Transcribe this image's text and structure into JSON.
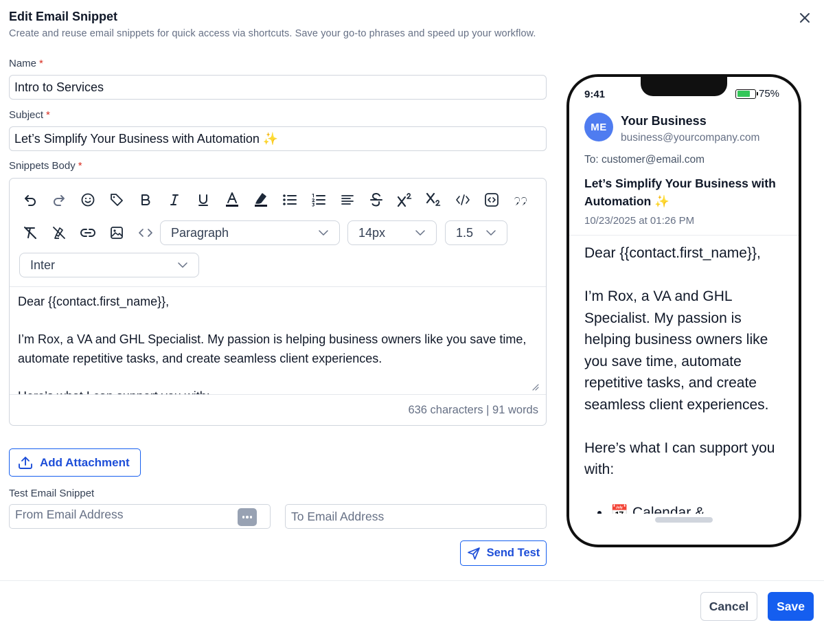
{
  "modal": {
    "title": "Edit Email Snippet",
    "description": "Create and reuse email snippets for quick access via shortcuts. Save your go-to phrases and speed up your workflow."
  },
  "form": {
    "name_label": "Name",
    "name_value": "Intro to Services",
    "subject_label": "Subject",
    "subject_value": "Let’s Simplify Your Business with Automation ✨",
    "body_label": "Snippets Body",
    "required_mark": "*"
  },
  "editor": {
    "toolbar_icons": [
      "undo-icon",
      "redo-icon",
      "emoji-icon",
      "tag-icon",
      "bold-icon",
      "italic-icon",
      "underline-icon",
      "text-color-icon",
      "highlight-icon",
      "bullet-list-icon",
      "numbered-list-icon",
      "align-icon",
      "strikethrough-icon",
      "superscript-icon",
      "subscript-icon",
      "code-icon",
      "code-block-icon",
      "quote-icon",
      "clear-format-icon",
      "clear-highlight-icon",
      "link-icon",
      "image-icon",
      "source-code-icon"
    ],
    "paragraph_select": "Paragraph",
    "size_select": "14px",
    "line_height_select": "1.5",
    "font_select": "Inter",
    "body_lines": [
      "Dear {{contact.first_name}},",
      "",
      "I’m Rox, a VA and GHL Specialist. My passion is helping business owners like you save time, automate repetitive tasks, and create seamless client experiences.",
      "",
      "Here’s what I can support you with:"
    ],
    "count_text": "636 characters | 91 words"
  },
  "attachment": {
    "label": "Add Attachment"
  },
  "test": {
    "label": "Test Email Snippet",
    "from_placeholder": "From Email Address",
    "to_placeholder": "To Email Address",
    "send_label": "Send Test"
  },
  "footer": {
    "cancel_label": "Cancel",
    "save_label": "Save"
  },
  "preview": {
    "time": "9:41",
    "battery_text": "75%",
    "battery_level": 0.75,
    "avatar_initials": "ME",
    "sender_name": "Your Business",
    "sender_email": "business@yourcompany.com",
    "to_line": "To: customer@email.com",
    "subject": "Let’s Simplify Your Business with Automation ✨",
    "date": "10/23/2025 at 01:26 PM",
    "body_paragraphs": [
      "Dear {{contact.first_name}},",
      "",
      "I’m Rox, a VA and GHL Specialist. My passion is helping business owners like you save time, automate repetitive tasks, and create seamless client experiences.",
      "",
      "Here’s what I can support you with:"
    ],
    "bullet_items": [
      "📅 Calendar &"
    ]
  },
  "colors": {
    "primary": "#155eef",
    "avatar": "#4f7cf0",
    "battery": "#34c759",
    "required": "#d92d20"
  }
}
